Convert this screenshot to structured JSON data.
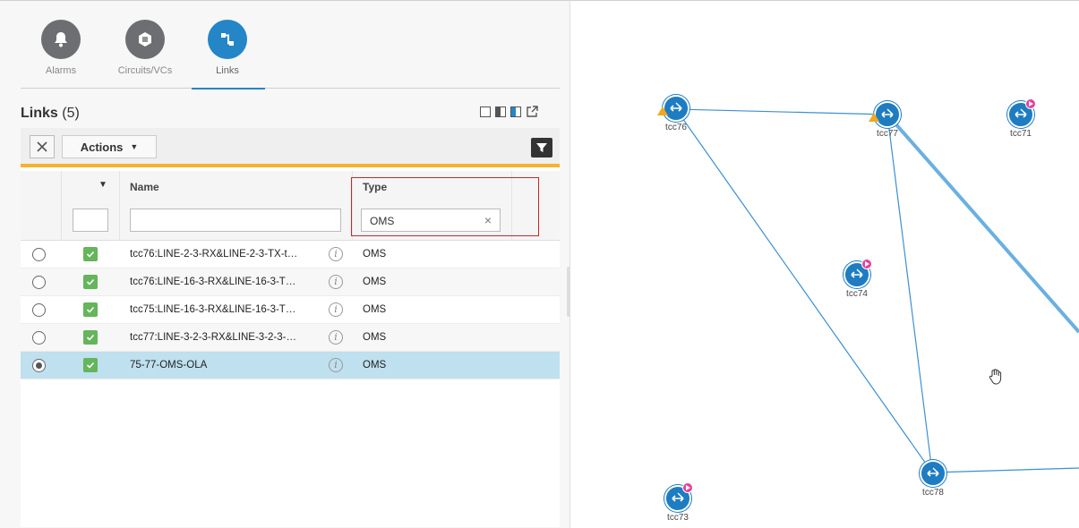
{
  "tabs": [
    {
      "label": "Alarms",
      "icon": "bell-icon"
    },
    {
      "label": "Circuits/VCs",
      "icon": "circuits-icon"
    },
    {
      "label": "Links",
      "icon": "links-icon",
      "active": true
    }
  ],
  "links_panel": {
    "title": "Links",
    "count": "(5)",
    "actions_label": "Actions",
    "columns": {
      "name": "Name",
      "type": "Type"
    },
    "filters": {
      "name": "",
      "type": "OMS"
    },
    "rows": [
      {
        "name": "tcc76:LINE-2-3-RX&LINE-2-3-TX-t…",
        "type": "OMS",
        "selected": false
      },
      {
        "name": "tcc76:LINE-16-3-RX&LINE-16-3-T…",
        "type": "OMS",
        "selected": false
      },
      {
        "name": "tcc75:LINE-16-3-RX&LINE-16-3-T…",
        "type": "OMS",
        "selected": false
      },
      {
        "name": "tcc77:LINE-3-2-3-RX&LINE-3-2-3-…",
        "type": "OMS",
        "selected": false
      },
      {
        "name": "75-77-OMS-OLA",
        "type": "OMS",
        "selected": true
      }
    ]
  },
  "map": {
    "nodes": [
      {
        "id": "tcc76",
        "label": "tcc76",
        "alarm": "warning"
      },
      {
        "id": "tcc77",
        "label": "tcc77",
        "alarm": "warning"
      },
      {
        "id": "tcc71",
        "label": "tcc71",
        "alarm": "pending"
      },
      {
        "id": "tcc74",
        "label": "tcc74",
        "alarm": "pending"
      },
      {
        "id": "tcc78",
        "label": "tcc78",
        "alarm": "none"
      },
      {
        "id": "tcc73",
        "label": "tcc73",
        "alarm": "pending"
      }
    ],
    "links": [
      {
        "from": "tcc76",
        "to": "tcc77"
      },
      {
        "from": "tcc76",
        "to": "tcc78"
      },
      {
        "from": "tcc77",
        "to": "tcc78"
      },
      {
        "from": "tcc77",
        "to": "offscreen-right",
        "highlighted": true
      },
      {
        "from": "tcc78",
        "to": "offscreen-right"
      }
    ]
  },
  "colors": {
    "accent": "#2486c7",
    "selected_row": "#bfe0ef",
    "toolbar_underline": "#f5b22e",
    "filter_highlight": "#c9252c",
    "checkbox_green": "#64b55b",
    "node_blue": "#1e7cc2",
    "alarm_pink": "#e5409c",
    "alarm_warning": "#f0a81e"
  }
}
